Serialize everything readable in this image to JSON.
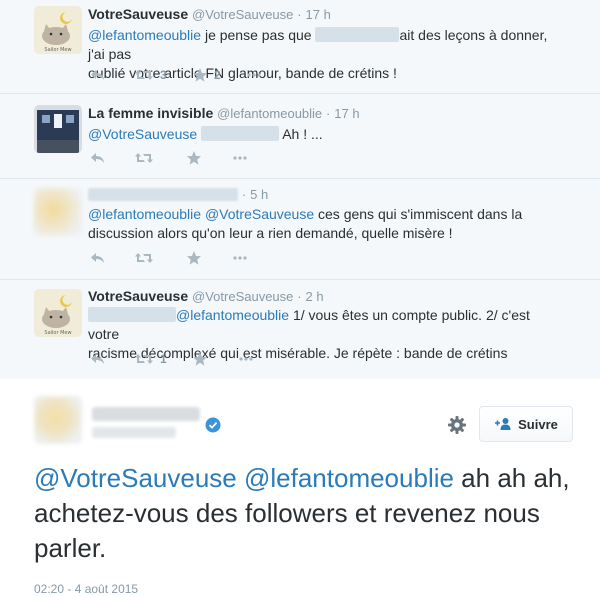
{
  "tweets": [
    {
      "name": "VotreSauveuse",
      "handle": "@VotreSauveuse",
      "sep": "·",
      "time": "17 h",
      "line1_mention": "@lefantomeoublie",
      "line1_a": " je pense pas que ",
      "line1_b": "ait des leçons à donner, j'ai pas",
      "line2": "oublié votre article FN glamour, bande de crétins !",
      "retweets": "3",
      "favorites": "2",
      "avatar_caption": "Sailor Mew"
    },
    {
      "name": "La femme invisible",
      "handle": "@lefantomeoublie",
      "sep": "·",
      "time": "17 h",
      "line1_mention": "@VotreSauveuse",
      "line1_a": "Ah ! ..."
    },
    {
      "sep": "·",
      "time": "5 h",
      "line1_mention_a": "@lefantomeoublie",
      "line1_mention_b": "@VotreSauveuse",
      "line1_a": " ces gens qui s'immiscent dans la",
      "line2": "discussion alors qu'on leur a rien demandé, quelle misère !"
    },
    {
      "name": "VotreSauveuse",
      "handle": "@VotreSauveuse",
      "sep": "·",
      "time": "2 h",
      "line1_mention": "@lefantomeoublie",
      "line1_a": " 1/ vous êtes un compte public. 2/ c'est votre",
      "line2": "racisme décomplexé qui est misérable. Je répète : bande de crétins",
      "retweets": "1",
      "avatar_caption": "Sailor Mew"
    }
  ],
  "main_tweet": {
    "follow_label": "Suivre",
    "mention_a": "@VotreSauveuse",
    "mention_b": "@lefantomeoublie",
    "text_a": " ah ah ah,",
    "text_line2": "achetez-vous des followers et revenez nous",
    "text_line3": "parler.",
    "timestamp": "02:20 - 4 août 2015"
  },
  "colors": {
    "link": "#2b7bb9",
    "verified": "#3b94d9",
    "icon": "#aab8c2"
  }
}
